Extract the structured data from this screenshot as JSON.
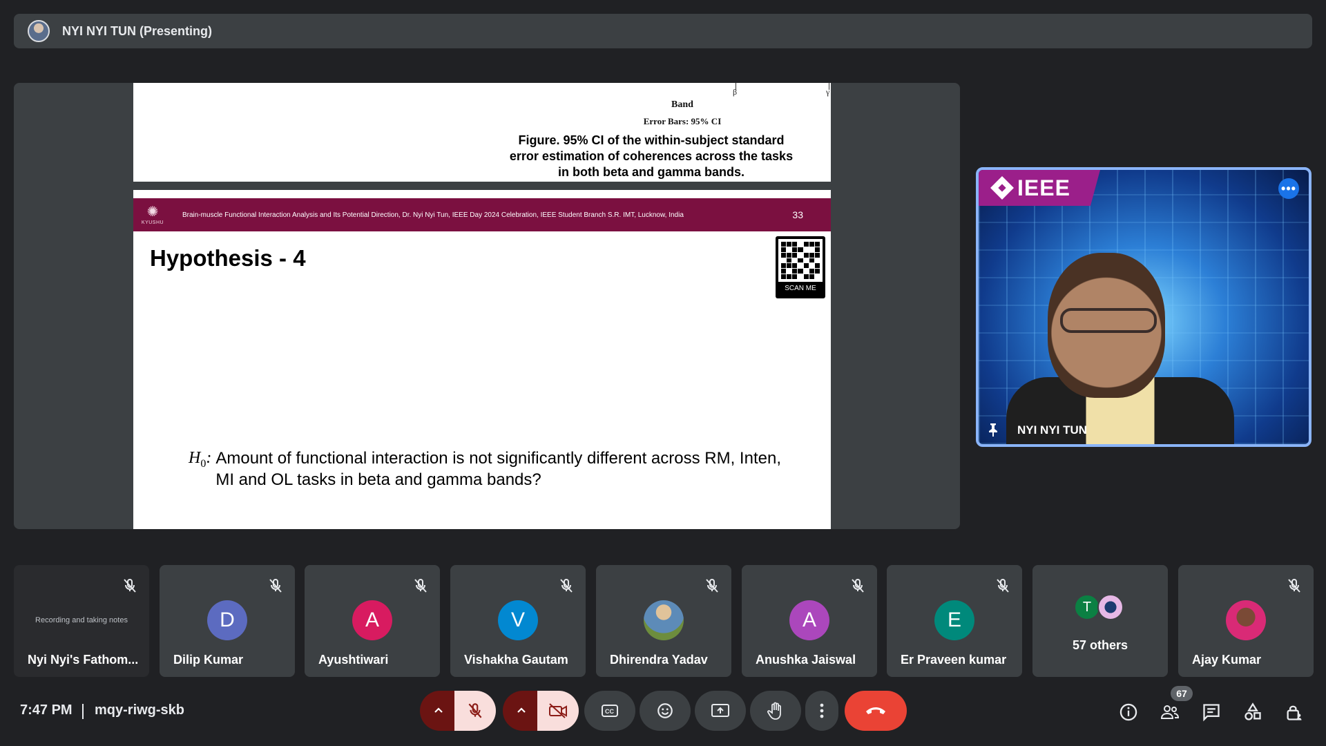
{
  "presenter_bar": {
    "label": "NYI NYI TUN (Presenting)"
  },
  "slide_prev": {
    "tick_labels": [
      "β",
      "γ"
    ],
    "axis_label": "Band",
    "error_bars": "Error Bars: 95% CI",
    "caption": "Figure. 95% CI of the within-subject standard error estimation of coherences across the tasks in both beta and gamma bands."
  },
  "slide": {
    "university": "KYUSHU",
    "header_text": "Brain-muscle Functional Interaction Analysis and Its Potential Direction, Dr. Nyi Nyi Tun, IEEE Day 2024 Celebration, IEEE Student Branch S.R. IMT, Lucknow, India",
    "page_number": "33",
    "title": "Hypothesis - 4",
    "qr_label": "SCAN ME",
    "hypothesis_symbol": "H",
    "hypothesis_subscript": "0",
    "hypothesis_colon": ":",
    "hypothesis_text": "Amount of functional interaction is not significantly different across RM, Inten, MI and OL tasks in beta and gamma bands?"
  },
  "speaker": {
    "badge": "IEEE",
    "name": "NYI NYI TUN",
    "more_icon": "more-horizontal-icon",
    "pin_icon": "pin-icon"
  },
  "participants": [
    {
      "name": "Nyi Nyi's Fathom...",
      "note": "Recording and taking notes",
      "type": "recorder"
    },
    {
      "name": "Dilip Kumar",
      "initial": "D",
      "color": "#5c6bc0"
    },
    {
      "name": "Ayushtiwari",
      "initial": "A",
      "color": "#d81b60"
    },
    {
      "name": "Vishakha Gautam",
      "initial": "V",
      "color": "#0288d1"
    },
    {
      "name": "Dhirendra Yadav",
      "type": "photo"
    },
    {
      "name": "Anushka Jaiswal",
      "initial": "A",
      "color": "#ab47bc"
    },
    {
      "name": "Er Praveen kumar",
      "initial": "E",
      "color": "#00897b"
    },
    {
      "name": "57 others",
      "initial": "T",
      "color": "#0b8043",
      "type": "others"
    },
    {
      "name": "Ajay Kumar",
      "type": "photo"
    }
  ],
  "bottom_bar": {
    "time": "7:47 PM",
    "meeting_code": "mqy-riwg-skb",
    "people_count": "67"
  },
  "colors": {
    "background": "#202124",
    "tile": "#3c4043",
    "accent_blue": "#8ab4f8",
    "end_call": "#ea4335",
    "slide_header": "#7b1040"
  }
}
